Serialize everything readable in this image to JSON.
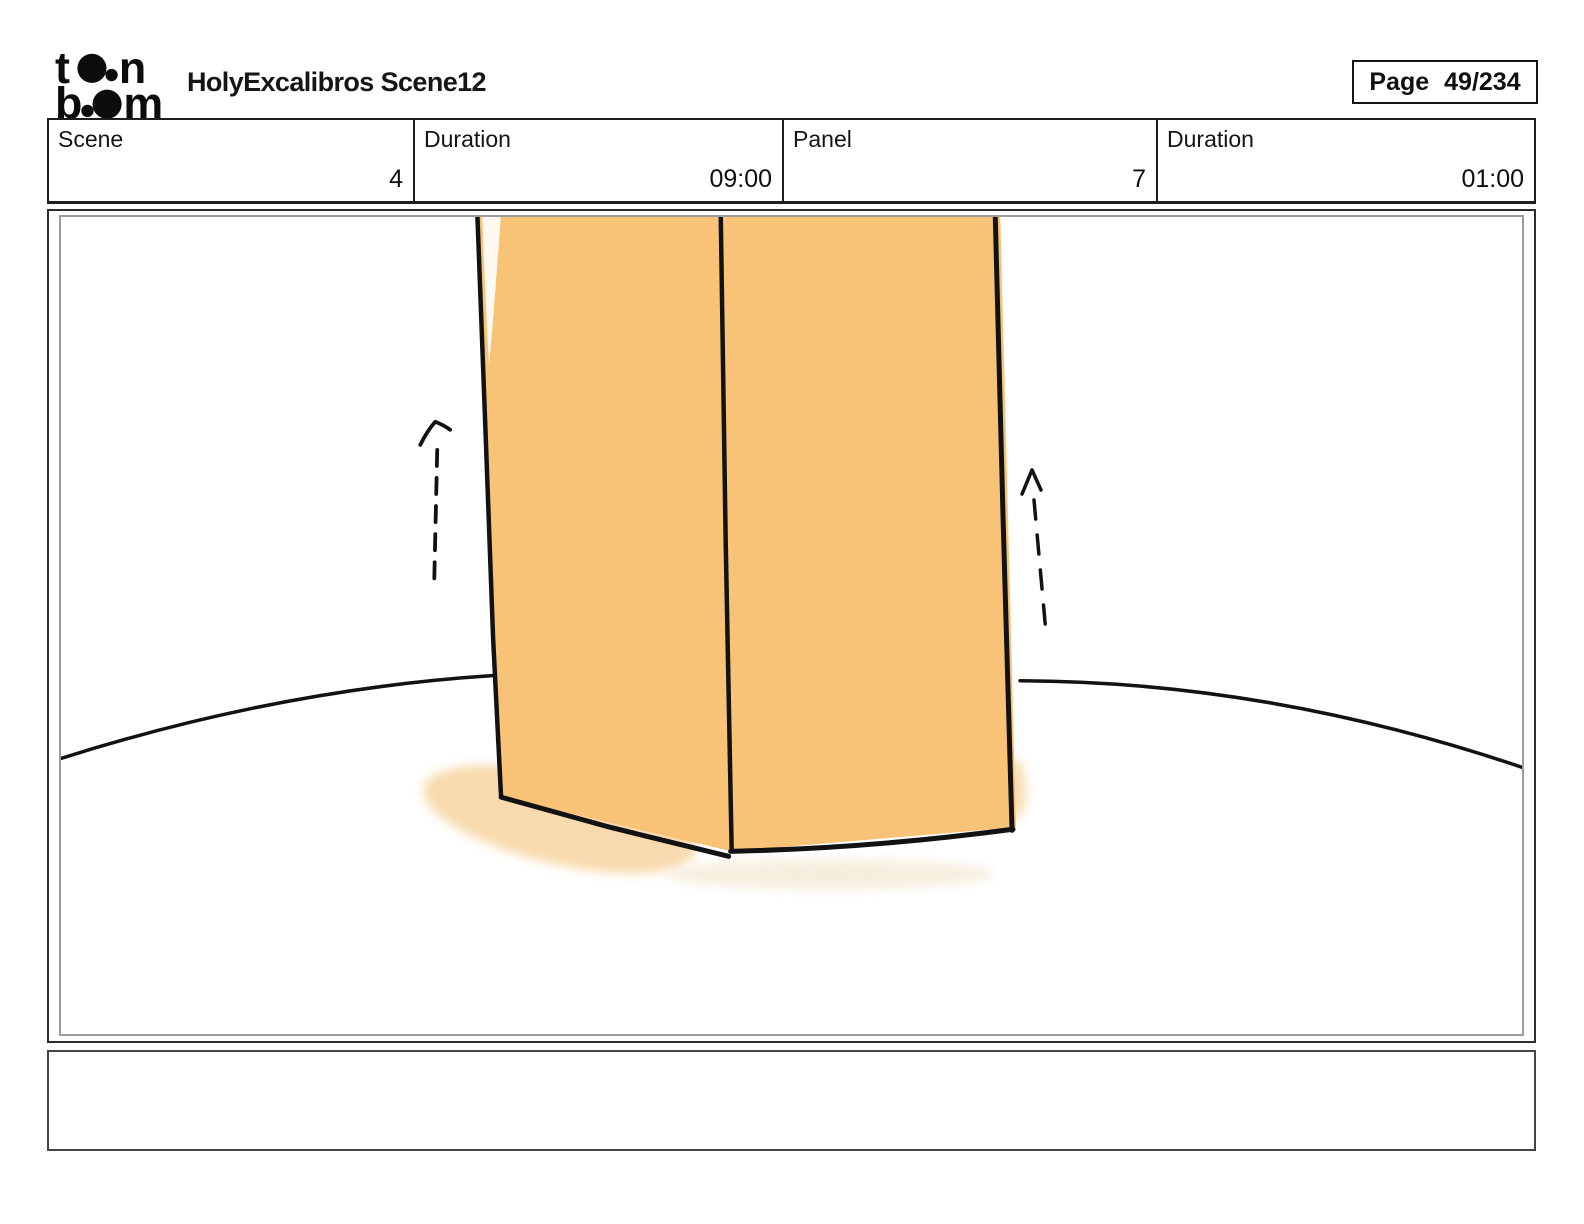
{
  "header": {
    "logo": {
      "alt": "toon boom",
      "t": "t",
      "n": "n",
      "b": "b",
      "m": "m"
    },
    "title": "HolyExcalibros Scene12",
    "page_label": "Page",
    "page_value": "49/234"
  },
  "info_table": {
    "cells": [
      {
        "label": "Scene",
        "value": "4"
      },
      {
        "label": "Duration",
        "value": "09:00"
      },
      {
        "label": "Panel",
        "value": "7"
      },
      {
        "label": "Duration",
        "value": "01:00"
      }
    ]
  },
  "caption": {
    "text": ""
  },
  "colors": {
    "ink": "#121212",
    "pillar_fill": "#f8c377",
    "pillar_shadow": "#f6d29a",
    "soft_shadow": "#f6ecdb"
  }
}
